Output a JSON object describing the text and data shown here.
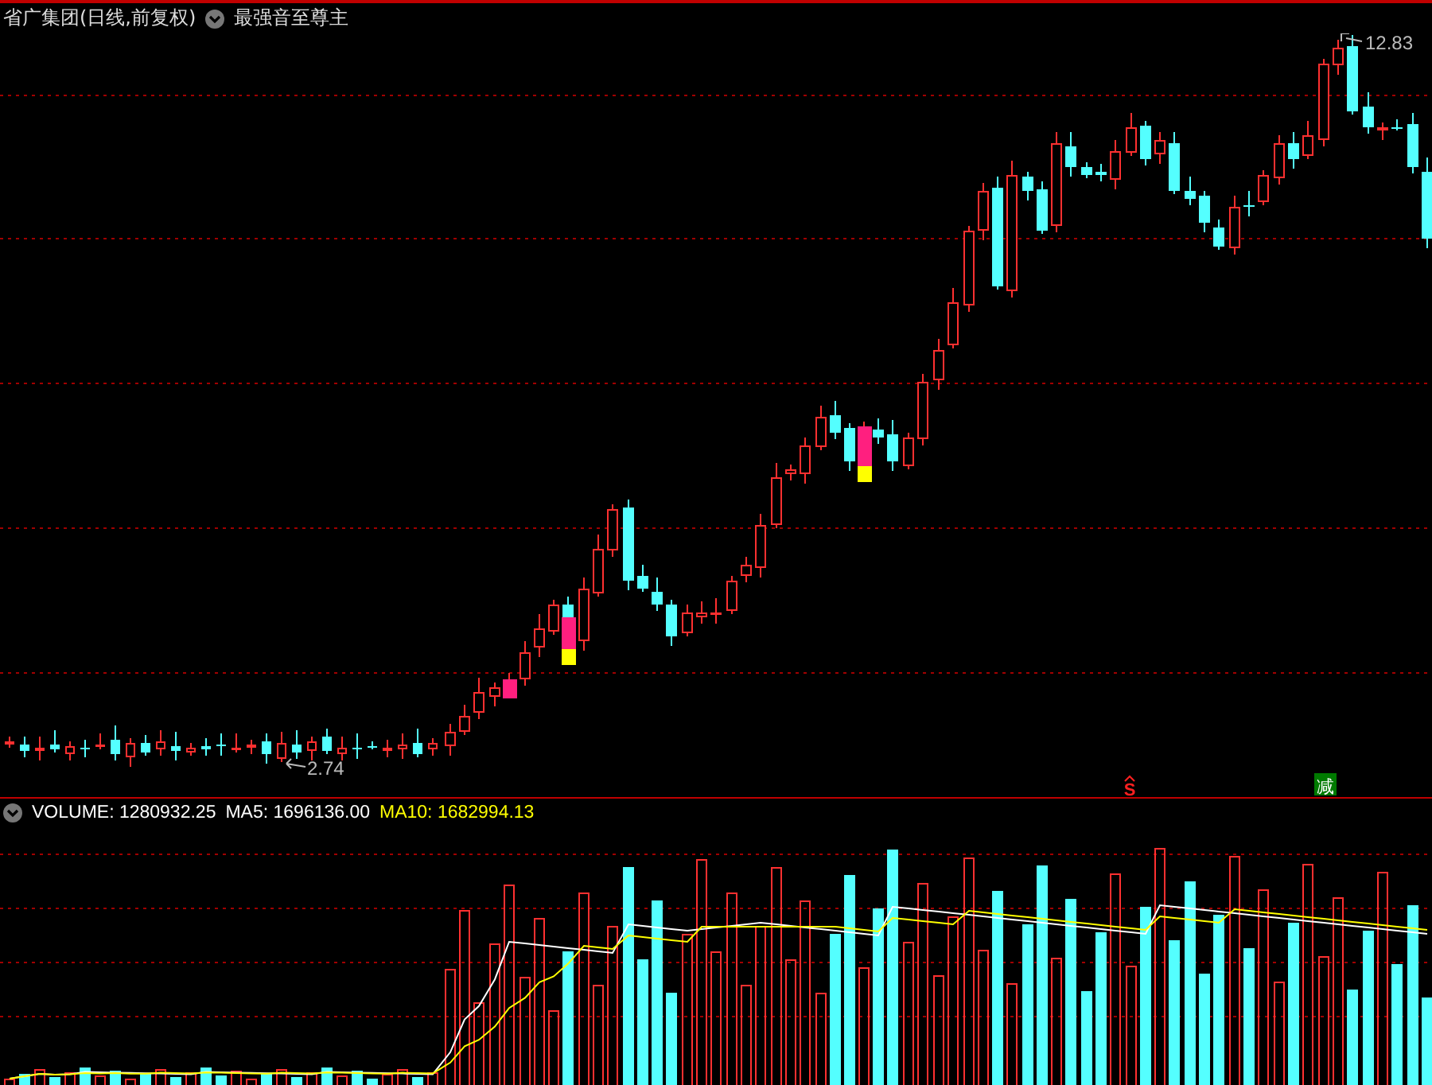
{
  "header": {
    "title": "省广集团(日线,前复权)",
    "indicator": "最强音至尊主"
  },
  "price_chart": {
    "high_label": "12.83",
    "low_label": "2.74",
    "signals": [
      {
        "kind": "buy",
        "text": "S"
      },
      {
        "kind": "reduce",
        "text": "减"
      }
    ]
  },
  "volume_panel": {
    "legend": [
      {
        "text": "VOLUME: 1280932.25",
        "color": "#ffffff"
      },
      {
        "text": "MA5: 1696136.00",
        "color": "#ffffff"
      },
      {
        "text": "MA10: 1682994.13",
        "color": "#ffff00"
      }
    ]
  }
}
